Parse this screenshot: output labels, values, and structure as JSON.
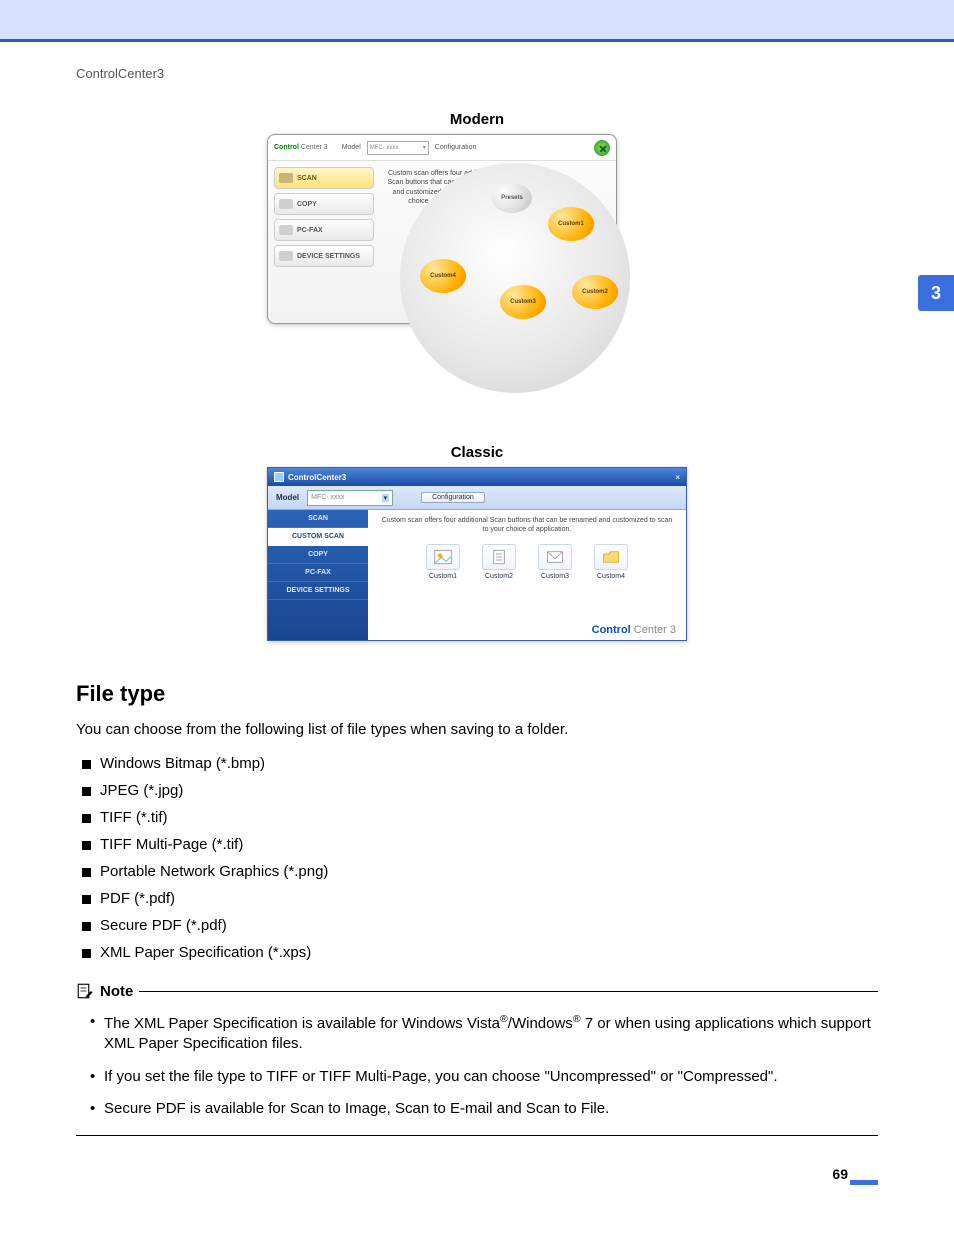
{
  "breadcrumb": "ControlCenter3",
  "chapter_number": "3",
  "page_number": "69",
  "modern": {
    "title": "Modern",
    "logo_bold": "Control",
    "logo_light": " Center 3",
    "model_label": "Model",
    "model_value": "MFC- xxxx",
    "config_label": "Configuration",
    "nav": [
      "SCAN",
      "COPY",
      "PC-FAX",
      "DEVICE SETTINGS"
    ],
    "description": "Custom scan offers four additional Scan buttons that can be renamed and customized to scan to your choice of application.",
    "bubbles": {
      "presets": "Presets",
      "c1": "Custom1",
      "c2": "Custom2",
      "c3": "Custom3",
      "c4": "Custom4"
    }
  },
  "classic": {
    "title": "Classic",
    "window_title": "ControlCenter3",
    "model_label": "Model",
    "model_value": "MFC- xxxx",
    "config_label": "Configuration",
    "nav": [
      "SCAN",
      "CUSTOM SCAN",
      "COPY",
      "PC-FAX",
      "DEVICE SETTINGS"
    ],
    "active_nav_index": 1,
    "description": "Custom scan offers four additional Scan buttons that can be renamed and customized to scan to your choice of application.",
    "icons": [
      "Custom1",
      "Custom2",
      "Custom3",
      "Custom4"
    ],
    "footer_bold": "Control",
    "footer_light": " Center 3"
  },
  "section": {
    "heading": "File type",
    "intro": "You can choose from the following list of file types when saving to a folder.",
    "items": [
      "Windows Bitmap (*.bmp)",
      "JPEG (*.jpg)",
      "TIFF (*.tif)",
      "TIFF Multi-Page (*.tif)",
      "Portable Network Graphics (*.png)",
      "PDF (*.pdf)",
      "Secure PDF (*.pdf)",
      "XML Paper Specification (*.xps)"
    ]
  },
  "note": {
    "label": "Note",
    "items_html": [
      "The XML Paper Specification is available for Windows Vista<sup>®</sup>/Windows<sup>®</sup> 7 or when using applications which support XML Paper Specification files.",
      "If you set the file type to TIFF or TIFF Multi-Page, you can choose \"Uncompressed\" or \"Compressed\".",
      "Secure PDF is available for Scan to Image, Scan to E-mail and Scan to File."
    ]
  }
}
